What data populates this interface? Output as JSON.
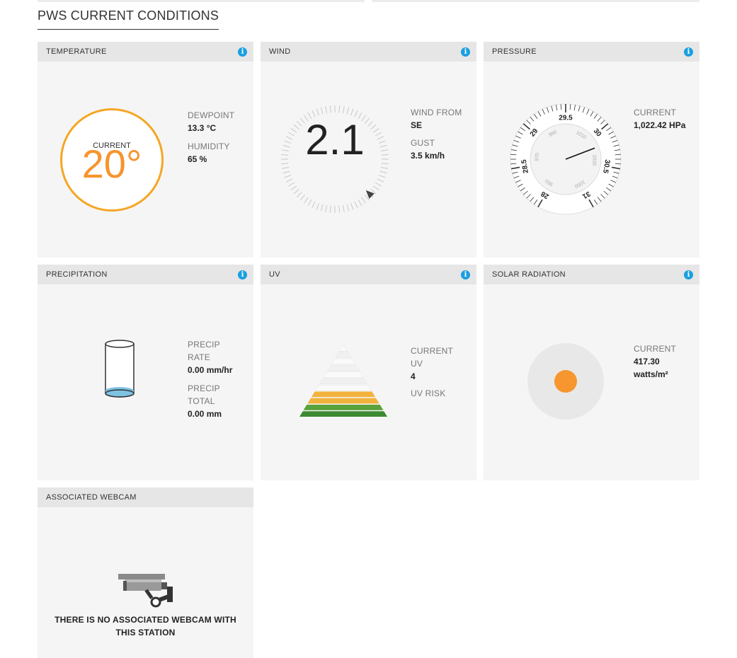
{
  "page": {
    "title": "PWS CURRENT CONDITIONS"
  },
  "cards": {
    "temperature": {
      "title": "TEMPERATURE",
      "current_label": "CURRENT",
      "current_value": "20°",
      "dewpoint_label": "DEWPOINT",
      "dewpoint_value": "13.3 °C",
      "humidity_label": "HUMIDITY",
      "humidity_value": "65 %",
      "ring_color": "#f5a623"
    },
    "wind": {
      "title": "WIND",
      "speed": "2.1",
      "direction_degrees": 135,
      "from_label": "WIND FROM",
      "from_value": "SE",
      "gust_label": "GUST",
      "gust_value": "3.5 km/h"
    },
    "pressure": {
      "title": "PRESSURE",
      "current_label": "CURRENT",
      "current_value": "1,022.42 HPa",
      "outer_ticks": [
        "28",
        "28.5",
        "29",
        "29.5",
        "30",
        "30.5",
        "31"
      ],
      "inner_ticks": [
        "950",
        "970",
        "990",
        "1010",
        "1030",
        "1050"
      ],
      "needle_inhg": 30.19
    },
    "precipitation": {
      "title": "PRECIPITATION",
      "rate_label_1": "PRECIP",
      "rate_label_2": "RATE",
      "rate_value": "0.00 mm/hr",
      "total_label_1": "PRECIP",
      "total_label_2": "TOTAL",
      "total_value": "0.00 mm",
      "water_color": "#7ec3e2"
    },
    "uv": {
      "title": "UV",
      "current_label_1": "CURRENT",
      "current_label_2": "UV",
      "current_value": "4",
      "risk_label": "UV RISK",
      "level": 4
    },
    "solar": {
      "title": "SOLAR RADIATION",
      "current_label": "CURRENT",
      "current_value": "417.30",
      "unit": "watts/m²",
      "sun_color": "#f7962f"
    },
    "webcam": {
      "title": "ASSOCIATED WEBCAM",
      "message": "THERE IS NO ASSOCIATED WEBCAM WITH THIS STATION"
    }
  },
  "icons": {
    "info": "info-icon",
    "info_glyph": "i",
    "camera": "security-camera-icon"
  }
}
